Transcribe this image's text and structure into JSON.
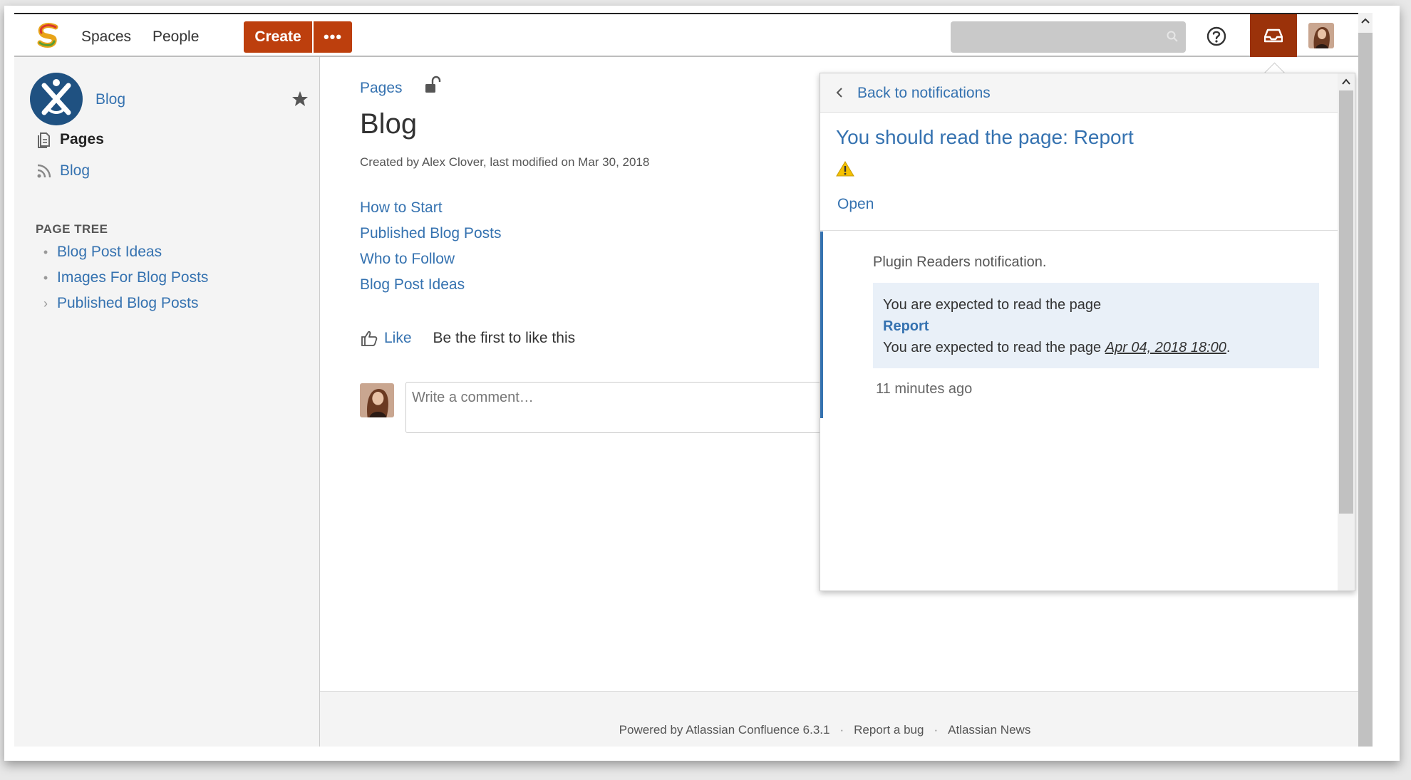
{
  "header": {
    "nav": [
      "Spaces",
      "People"
    ],
    "create_label": "Create",
    "more_label": "•••",
    "search_placeholder": ""
  },
  "sidebar": {
    "space_name": "Blog",
    "links": [
      {
        "label": "Pages",
        "icon": "pages-icon",
        "bold": true
      },
      {
        "label": "Blog",
        "icon": "rss-icon",
        "bold": false
      }
    ],
    "page_tree_title": "PAGE TREE",
    "tree": [
      {
        "label": "Blog Post Ideas",
        "marker": "•"
      },
      {
        "label": "Images For Blog Posts",
        "marker": "•"
      },
      {
        "label": "Published Blog Posts",
        "marker": "›"
      }
    ]
  },
  "main": {
    "breadcrumb": "Pages",
    "title": "Blog",
    "byline": "Created by Alex Clover, last modified on Mar 30, 2018",
    "links": [
      "How to Start",
      "Published Blog Posts",
      "Who to Follow",
      "Blog Post Ideas"
    ],
    "like_label": "Like",
    "like_desc": "Be the first to like this",
    "comment_placeholder": "Write a comment…"
  },
  "footer": {
    "items": [
      "Powered by Atlassian Confluence 6.3.1",
      "Report a bug",
      "Atlassian News"
    ],
    "separator": "·"
  },
  "notification": {
    "back_label": "Back to notifications",
    "title": "You should read the page: Report",
    "open_label": "Open",
    "source": "Plugin Readers notification.",
    "body_line1": "You are expected to read the page",
    "body_page": "Report",
    "body_line3_prefix": "You are expected to read the page",
    "body_date": "Apr 04, 2018 18:00",
    "body_suffix": ".",
    "time": "11 minutes ago"
  },
  "colors": {
    "brand_orange": "#bd3f0d",
    "link_blue": "#3572b0",
    "notif_active": "#9b320a"
  }
}
